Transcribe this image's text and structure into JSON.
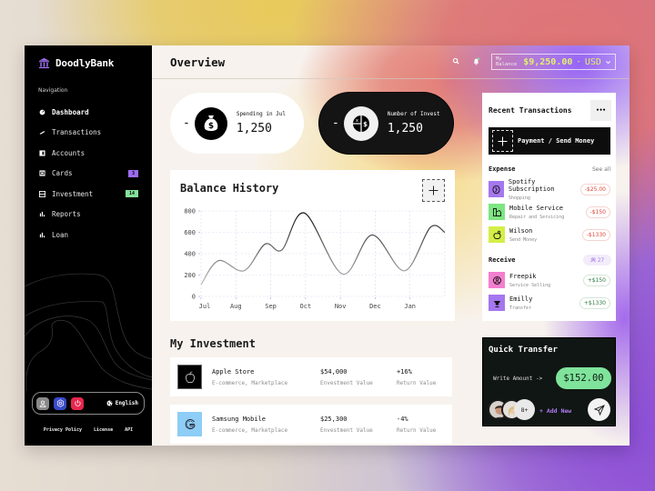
{
  "app": {
    "brand": "DoodlyBank",
    "accent": "#9b6cf0"
  },
  "sidebar": {
    "heading": "Navigation",
    "items": [
      {
        "label": "Dashboard",
        "icon": "dashboard-icon",
        "active": true
      },
      {
        "label": "Transactions",
        "icon": "transactions-icon"
      },
      {
        "label": "Accounts",
        "icon": "accounts-icon"
      },
      {
        "label": "Cards",
        "icon": "cards-icon",
        "badge": "3",
        "badge_color": "#9b6cf0"
      },
      {
        "label": "Investment",
        "icon": "investment-icon",
        "badge": "14",
        "badge_color": "#86e29a"
      },
      {
        "label": "Reports",
        "icon": "reports-icon"
      },
      {
        "label": "Loan",
        "icon": "loan-icon"
      }
    ],
    "footer": {
      "buttons": [
        {
          "name": "profile",
          "icon": "user-icon",
          "color": "#8a8a8a"
        },
        {
          "name": "settings",
          "icon": "settings-icon",
          "color": "#3a49c9"
        },
        {
          "name": "logout",
          "icon": "power-icon",
          "color": "#e8264d"
        }
      ],
      "language": "English",
      "links": [
        "Privacy Policy",
        "License",
        "API"
      ]
    }
  },
  "header": {
    "title": "Overview",
    "balance_label": "My Balance",
    "balance_amount": "$9,250.00",
    "separator": "-",
    "currency": "USD"
  },
  "stats": [
    {
      "label": "Spending in Jul",
      "value": "1,250",
      "prefix": "-",
      "icon": "money-bag-icon"
    },
    {
      "label": "Number of Invest",
      "value": "1,250",
      "prefix": "-",
      "icon": "invest-pie-icon"
    }
  ],
  "balance_history": {
    "title": "Balance History",
    "add_label": "+"
  },
  "chart_data": {
    "type": "line",
    "title": "Balance History",
    "xlabel": "",
    "ylabel": "",
    "categories": [
      "Jul",
      "Aug",
      "Sep",
      "Oct",
      "Nov",
      "Dec",
      "Jan"
    ],
    "x": [
      0,
      0.5,
      1.23,
      1.84,
      2.32,
      2.97,
      4.06,
      4.91,
      5.84,
      6.58,
      7.0
    ],
    "series": [
      {
        "name": "Balance",
        "values": [
          110,
          335,
          240,
          490,
          435,
          780,
          210,
          575,
          240,
          645,
          600
        ]
      }
    ],
    "yticks": [
      0,
      200,
      400,
      600,
      800
    ],
    "ylim": [
      0,
      800
    ],
    "xlim": [
      0,
      7
    ],
    "grid": true,
    "legend": "none"
  },
  "investments": {
    "title": "My Investment",
    "rows": [
      {
        "name": "Apple Store",
        "category": "E-commerce, Marketplace",
        "value": "$54,000",
        "value_label": "Envestment Value",
        "return": "+16%",
        "return_label": "Return Value",
        "logo": "apple-logo-icon",
        "logo_bg": "#000000"
      },
      {
        "name": "Samsung Mobile",
        "category": "E-commerce, Marketplace",
        "value": "$25,300",
        "value_label": "Envestment Value",
        "return": "-4%",
        "return_label": "Return Value",
        "logo": "google-logo-icon",
        "logo_bg": "#8ecdf6"
      }
    ]
  },
  "transactions": {
    "title": "Recent Transactions",
    "more_label": "•••",
    "pay_label": "Payment / Send Money",
    "expense_heading": "Expense",
    "see_all": "See all",
    "expenses": [
      {
        "name": "Spotify Subscription",
        "sub": "Shopping",
        "amount": "-$25.00",
        "icon_bg": "#a577ef"
      },
      {
        "name": "Mobile Service",
        "sub": "Repair and Servicing",
        "amount": "-$150",
        "icon_bg": "#7ee582"
      },
      {
        "name": "Wilson",
        "sub": "Send Money",
        "amount": "-$1330",
        "icon_bg": "#d4ee47"
      }
    ],
    "receive_heading": "Receive",
    "receive_count": "27",
    "receives": [
      {
        "name": "Freepik",
        "sub": "Service Selling",
        "amount": "+$150",
        "icon_bg": "#f47fcf"
      },
      {
        "name": "Emilly",
        "sub": "Transfer",
        "amount": "+$1330",
        "icon_bg": "#a577ef"
      }
    ],
    "expense_color": "#e0453a",
    "receive_color": "#2f7d3f"
  },
  "quick_transfer": {
    "title": "Quick Transfer",
    "write_label": "Write Amount ->",
    "amount": "$152.00",
    "more_contacts": "8+",
    "add_new": "+ Add New"
  }
}
